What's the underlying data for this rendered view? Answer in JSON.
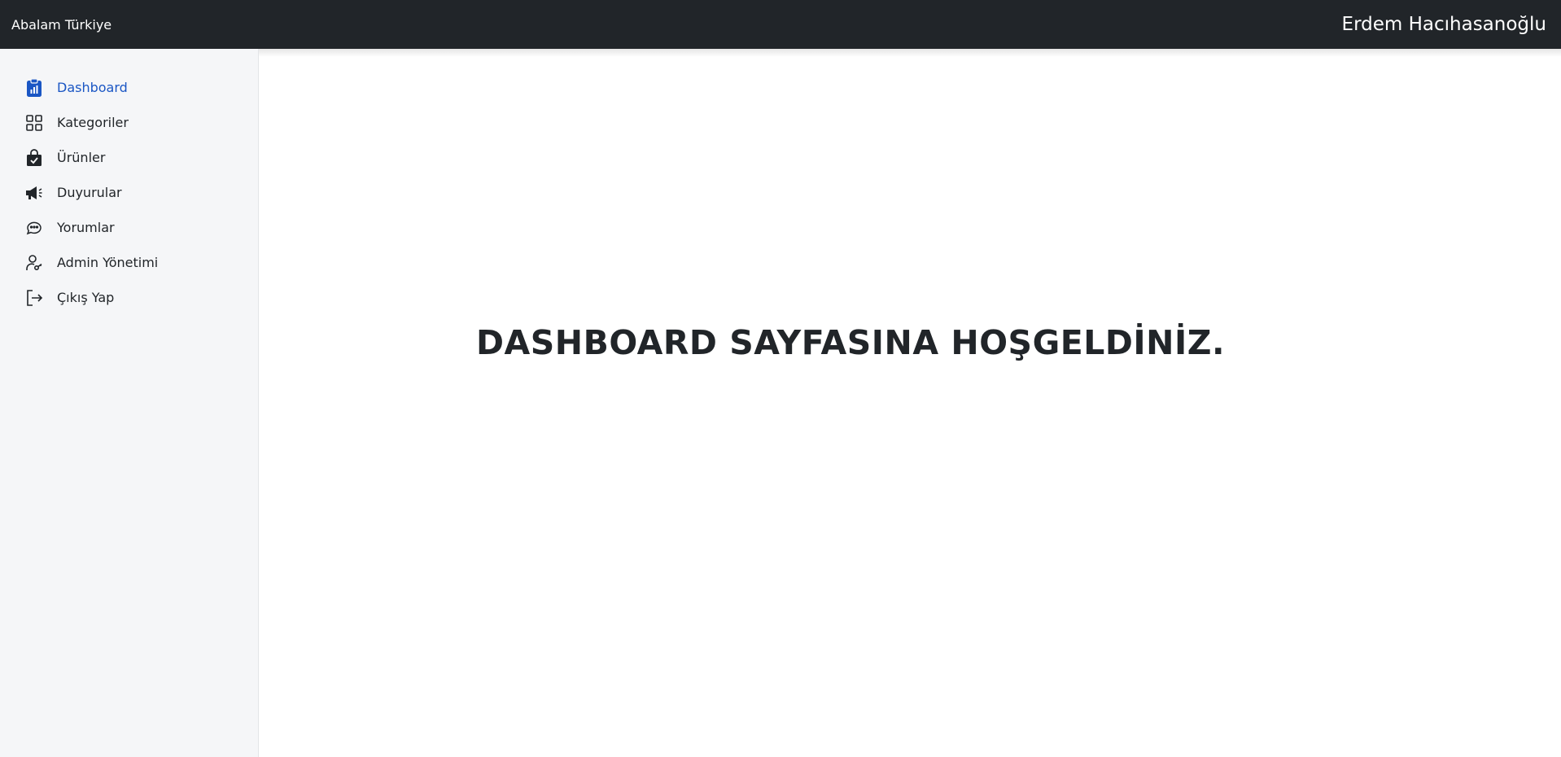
{
  "header": {
    "brand": "Abalam Türkiye",
    "user_name": "Erdem Hacıhasanoğlu"
  },
  "sidebar": {
    "items": [
      {
        "label": "Dashboard",
        "icon": "clipboard-chart-icon",
        "active": true
      },
      {
        "label": "Kategoriler",
        "icon": "grid-icon",
        "active": false
      },
      {
        "label": "Ürünler",
        "icon": "shopping-bag-check-icon",
        "active": false
      },
      {
        "label": "Duyurular",
        "icon": "megaphone-icon",
        "active": false
      },
      {
        "label": "Yorumlar",
        "icon": "chat-bubbles-icon",
        "active": false
      },
      {
        "label": "Admin Yönetimi",
        "icon": "user-key-icon",
        "active": false
      },
      {
        "label": "Çıkış Yap",
        "icon": "logout-icon",
        "active": false
      }
    ]
  },
  "main": {
    "welcome": "DASHBOARD SAYFASINA HOŞGELDİNİZ."
  },
  "colors": {
    "topbar": "#212529",
    "sidebar_bg": "#f5f6f8",
    "active": "#1a56c4",
    "text": "#212529"
  }
}
